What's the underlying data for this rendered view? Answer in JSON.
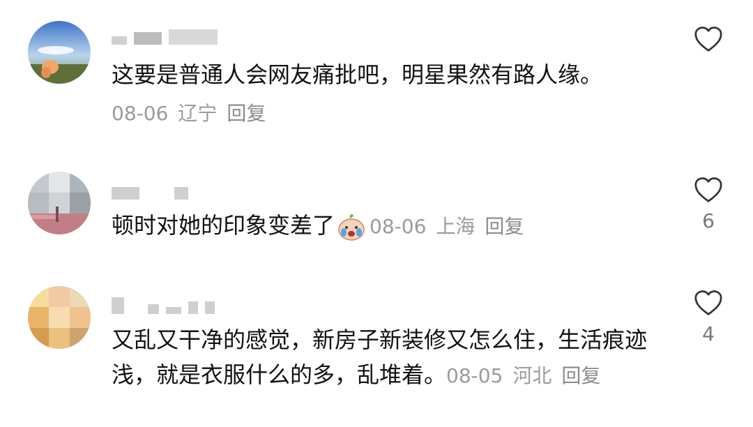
{
  "comments": [
    {
      "text": "这要是普通人会网友痛批吧，明星果然有路人缘。",
      "date": "08-06",
      "location": "辽宁",
      "reply_label": "回复",
      "like_count": "",
      "avatar_icon": "sky-hand-photo-avatar"
    },
    {
      "text": "顿时对她的印象变差了",
      "emoji": "crying-face-emoji",
      "date": "08-06",
      "location": "上海",
      "reply_label": "回复",
      "like_count": "6",
      "avatar_icon": "blurred-landscape-avatar"
    },
    {
      "text": "又乱又干净的感觉，新房子新装修又怎么住，生活痕迹浅，就是衣服什么的多，乱堆着。",
      "date": "08-05",
      "location": "河北",
      "reply_label": "回复",
      "like_count": "4",
      "avatar_icon": "blurred-food-avatar"
    }
  ],
  "colors": {
    "text": "#111111",
    "meta": "#9a9a9a",
    "blur": "#cfcfcf",
    "heart_stroke": "#333333"
  },
  "icons": {
    "like": "heart-outline-icon"
  }
}
